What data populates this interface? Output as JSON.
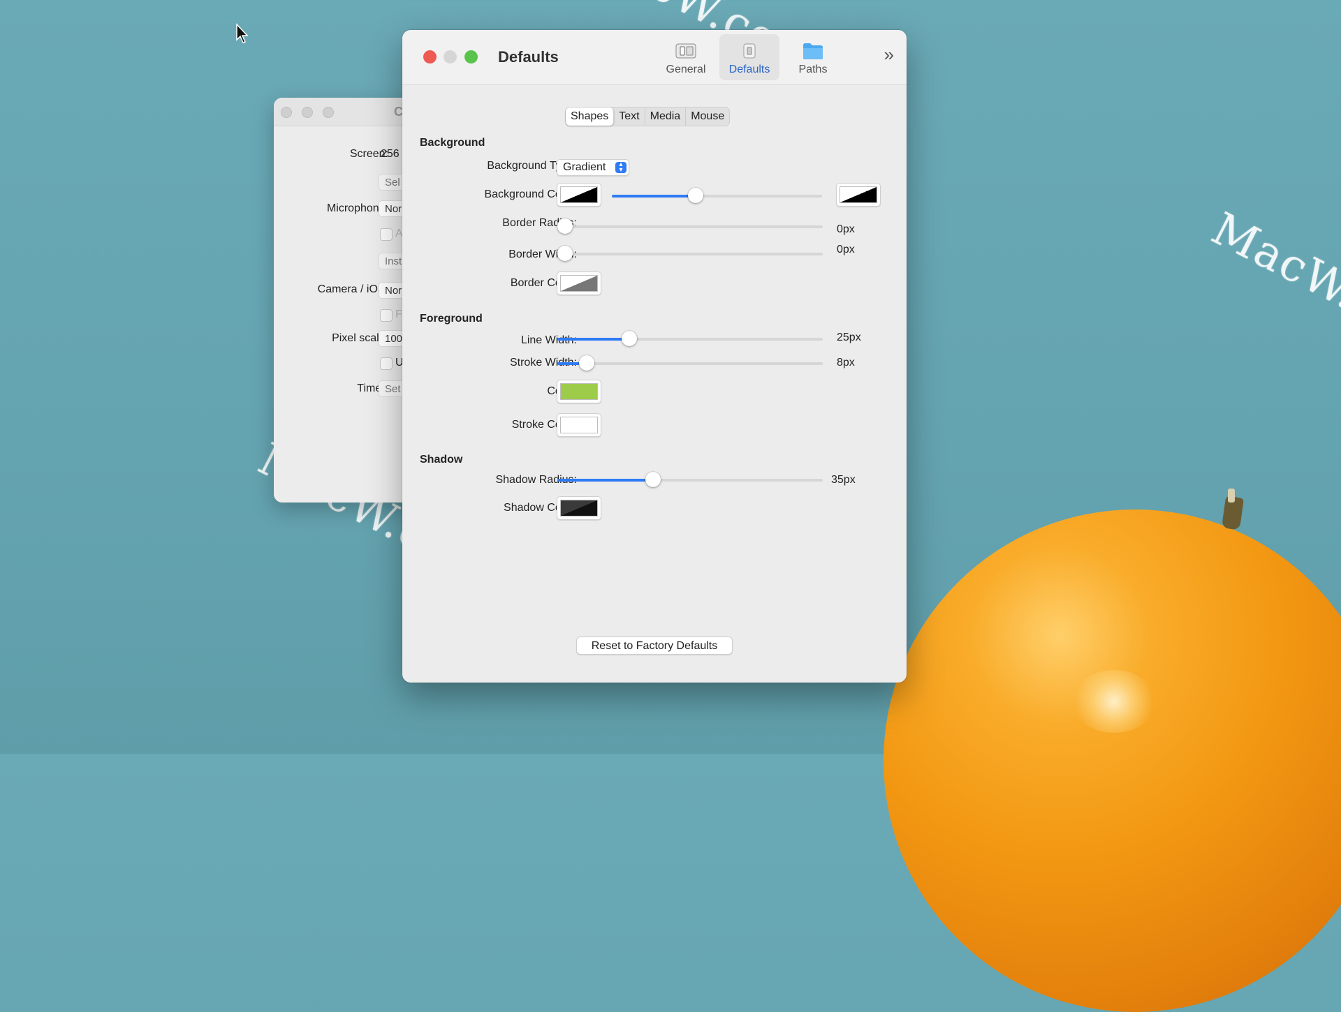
{
  "watermark": "MacW.com",
  "back_window": {
    "title": "C",
    "screen_label": "Screen:",
    "screen_value": "256",
    "select_button": "Sel",
    "microphone_label": "Microphone:",
    "microphone_value": "Nor",
    "microphone_option": "A",
    "install_button": "Inst",
    "camera_label": "Camera / iOS:",
    "camera_value": "Nor",
    "camera_option": "F",
    "pixel_scale_label": "Pixel scale:",
    "pixel_scale_value": "100",
    "pixel_option": "U",
    "timer_label": "Timer:",
    "timer_value": "Set"
  },
  "window": {
    "title": "Defaults",
    "toolbar": [
      {
        "label": "General",
        "icon": "general-icon",
        "selected": false
      },
      {
        "label": "Defaults",
        "icon": "defaults-icon",
        "selected": true
      },
      {
        "label": "Paths",
        "icon": "folder-icon",
        "selected": false
      }
    ],
    "tabs": [
      {
        "label": "Shapes",
        "selected": true
      },
      {
        "label": "Text",
        "selected": false
      },
      {
        "label": "Media",
        "selected": false
      },
      {
        "label": "Mouse",
        "selected": false
      }
    ],
    "background": {
      "heading": "Background",
      "type_label": "Background Type:",
      "type_value": "Gradient",
      "color_label": "Background Color:",
      "gradient_position": 0.4,
      "radius_label": "Border Radius:",
      "radius_value": "0px",
      "radius_level": 0,
      "width_label": "Border Width:",
      "width_value": "0px",
      "width_level": 0,
      "border_color_label": "Border Color:"
    },
    "foreground": {
      "heading": "Foreground",
      "line_width_label": "Line Width:",
      "line_width_value": "25px",
      "line_width_level": 0.27,
      "stroke_width_label": "Stroke Width:",
      "stroke_width_value": "8px",
      "stroke_width_level": 0.11,
      "color_label": "Color:",
      "color": "#9ccc4a",
      "stroke_color_label": "Stroke Color:",
      "stroke_color": "#ffffff"
    },
    "shadow": {
      "heading": "Shadow",
      "radius_label": "Shadow Radius:",
      "radius_value": "35px",
      "radius_level": 0.36,
      "color_label": "Shadow Color:"
    },
    "reset_button": "Reset to Factory Defaults"
  },
  "colors": {
    "accent": "#2f7bf5",
    "close": "#ee5a52",
    "zoom": "#5ac34b",
    "desktop": "#64a3b0"
  }
}
